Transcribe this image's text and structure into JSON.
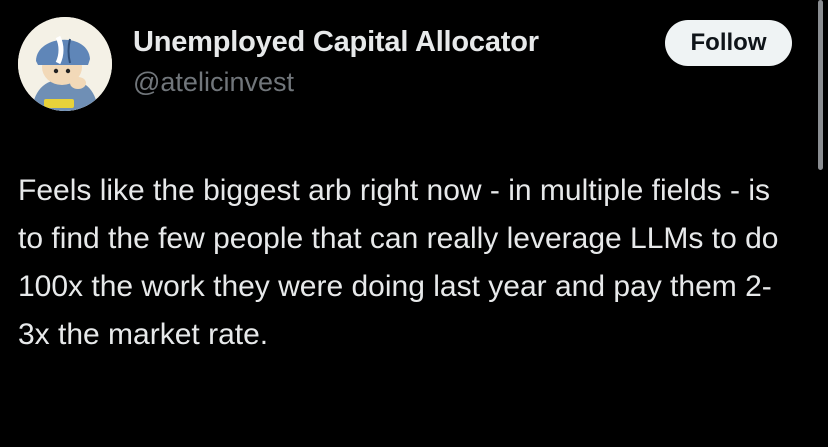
{
  "user": {
    "display_name": "Unemployed Capital Allocator",
    "handle": "@atelicinvest",
    "avatar_icon": "cartoon-avatar-icon",
    "avatar_badge_text": "small caps"
  },
  "follow_button": {
    "label": "Follow"
  },
  "tweet": {
    "text": "Feels like the biggest arb right now - in multiple fields - is to find the few people that can really leverage LLMs to do 100x the work they were doing last year and pay them 2-3x the market rate."
  },
  "colors": {
    "background": "#000000",
    "primary_text": "#e7e9ea",
    "secondary_text": "#71767b",
    "follow_button_bg": "#eff3f4"
  }
}
